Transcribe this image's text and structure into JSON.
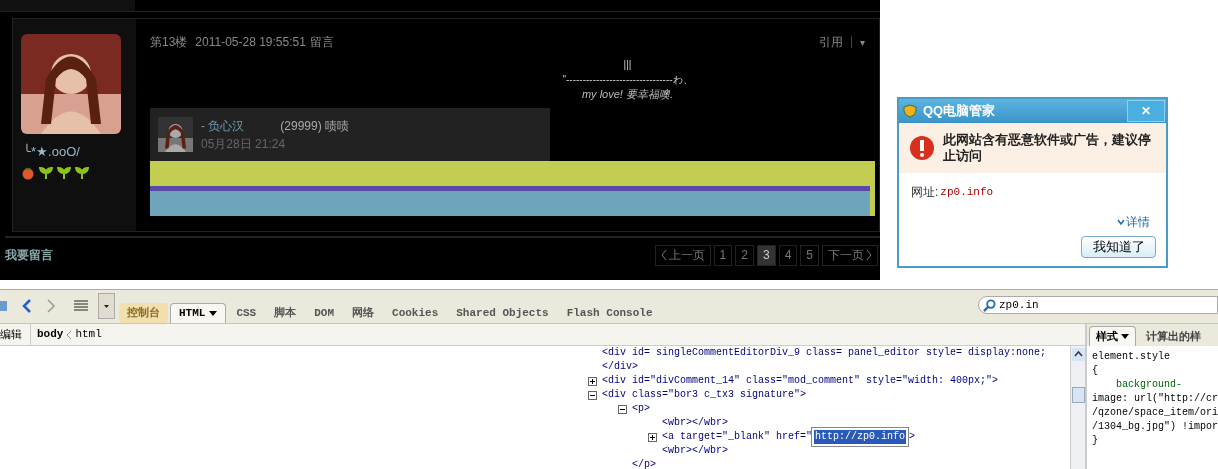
{
  "comment": {
    "author_name": "╰*★.ooO/",
    "floor": "第13楼",
    "timestamp": "2011-05-28 19:55:51",
    "action": "留言",
    "quote_link": "引用",
    "menu_caret": "▾",
    "signature": [
      "|||",
      "\"--------------------------------わ、",
      "my love! 要幸福噢."
    ],
    "reply": {
      "author": "- 负心汉",
      "text": "(29999) 啧啧",
      "time": "05月28日 21:24"
    }
  },
  "footer": {
    "leave_message": "我要留言",
    "pagination": [
      {
        "label": "上一页",
        "kind": "prev",
        "selected": false
      },
      {
        "label": "1",
        "kind": "page",
        "selected": false
      },
      {
        "label": "2",
        "kind": "page",
        "selected": false
      },
      {
        "label": "3",
        "kind": "page",
        "selected": true
      },
      {
        "label": "4",
        "kind": "page",
        "selected": false
      },
      {
        "label": "5",
        "kind": "page",
        "selected": false
      },
      {
        "label": "下一页",
        "kind": "next",
        "selected": false
      }
    ]
  },
  "dialog": {
    "title": "QQ电脑管家",
    "close": "✕",
    "warning": "此网站含有恶意软件或广告，建议停止访问",
    "url_label": "网址:",
    "url": "zp0.info",
    "details": "详情",
    "ok_button": "我知道了"
  },
  "devtools": {
    "tabs": [
      {
        "label": "控制台",
        "selected": false,
        "highlighted": true
      },
      {
        "label": "HTML",
        "selected": true,
        "highlighted": false,
        "dropdown": true
      },
      {
        "label": "CSS",
        "selected": false,
        "highlighted": false
      },
      {
        "label": "脚本",
        "selected": false,
        "highlighted": false
      },
      {
        "label": "DOM",
        "selected": false,
        "highlighted": false
      },
      {
        "label": "网络",
        "selected": false,
        "highlighted": false
      },
      {
        "label": "Cookies",
        "selected": false,
        "highlighted": false
      },
      {
        "label": "Shared Objects",
        "selected": false,
        "highlighted": false
      },
      {
        "label": "Flash Console",
        "selected": false,
        "highlighted": false
      }
    ],
    "search": {
      "value": "zp0.in"
    },
    "edit_button": "编辑",
    "breadcrumb": [
      "body",
      "html"
    ],
    "tree": [
      {
        "text": "<div id= singleCommentEditorDiv_9  class= panel_editor  style= display:none;"
      },
      {
        "text": "</div>"
      },
      {
        "text": "<div id=\"divComment_14\" class=\"mod_comment\" style=\"width: 400px;\">",
        "expanded": false
      },
      {
        "text": "<div class=\"bor3 c_tx3 signature\">",
        "expanded": true,
        "children": [
          {
            "text": "<p>",
            "expanded": true,
            "children": [
              {
                "text": "<wbr></wbr>"
              },
              {
                "text": "<a target=\"_blank\" href=\"",
                "tooltip": "http://zp0.info",
                "after": ">",
                "expanded": false
              },
              {
                "text": "<wbr></wbr>"
              }
            ]
          },
          {
            "text": "</p>"
          }
        ]
      }
    ],
    "side_tabs": [
      {
        "label": "样式",
        "selected": true
      },
      {
        "label": "计算出的样",
        "selected": false
      }
    ],
    "style_lines": [
      "element.style",
      "{",
      "    background-",
      "image: url(\"http://cr",
      "/qzone/space_item/ori",
      "/1304_bg.jpg\") !impor",
      "}"
    ]
  }
}
